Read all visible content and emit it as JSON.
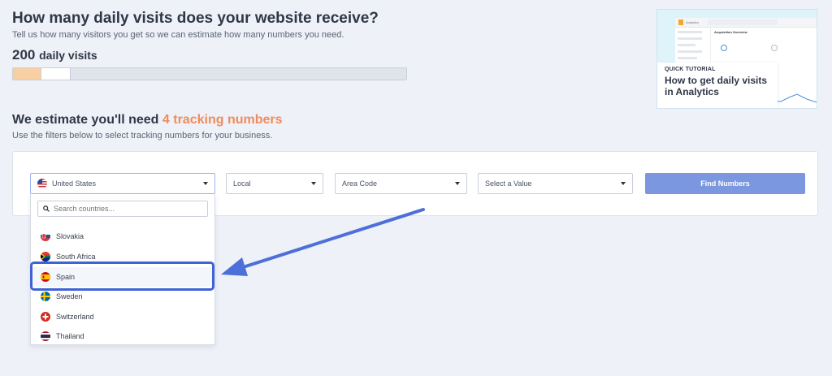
{
  "question": {
    "title": "How many daily visits does your website receive?",
    "subtitle": "Tell us how many visitors you get so we can estimate how many numbers you need.",
    "visits_value": "200",
    "visits_unit": "daily visits"
  },
  "estimate": {
    "prefix": "We estimate you'll need ",
    "highlight": "4 tracking numbers",
    "subtitle": "Use the filters below to select tracking numbers for your business."
  },
  "tutorial": {
    "kicker": "QUICK TUTORIAL",
    "heading": "How to get daily visits in Analytics",
    "mini_app_name": "Analytics",
    "mini_section": "Acquisition Overview"
  },
  "filters": {
    "country": "United States",
    "type": "Local",
    "area": "Area Code",
    "value": "Select a Value",
    "find_button": "Find Numbers",
    "search_placeholder": "Search countries..."
  },
  "countries": [
    {
      "name": "Slovakia"
    },
    {
      "name": "South Africa"
    },
    {
      "name": "Spain"
    },
    {
      "name": "Sweden"
    },
    {
      "name": "Switzerland"
    },
    {
      "name": "Thailand"
    }
  ],
  "colors": {
    "accent": "#f08b5c",
    "button": "#7b97df",
    "highlight": "#3f63d6"
  }
}
